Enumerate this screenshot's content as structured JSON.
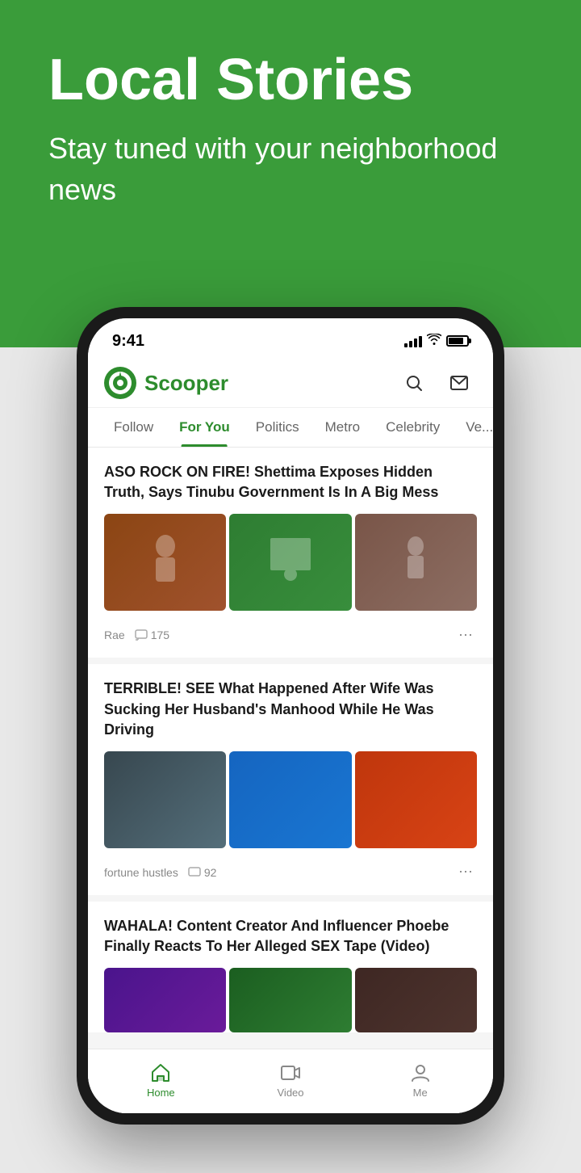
{
  "hero": {
    "title": "Local Stories",
    "subtitle": "Stay tuned with your neighborhood news"
  },
  "phone": {
    "status_bar": {
      "time": "9:41"
    },
    "header": {
      "logo_text": "Scooper"
    },
    "nav_tabs": [
      {
        "label": "Follow",
        "active": false
      },
      {
        "label": "For You",
        "active": true
      },
      {
        "label": "Politics",
        "active": false
      },
      {
        "label": "Metro",
        "active": false
      },
      {
        "label": "Celebrity",
        "active": false
      },
      {
        "label": "Ve...",
        "active": false
      }
    ],
    "articles": [
      {
        "title": "ASO ROCK ON FIRE! Shettima Exposes Hidden Truth, Says Tinubu Government Is In A Big Mess",
        "author": "Rae",
        "comments": "175",
        "images": [
          "img1-1",
          "img1-2",
          "img1-3"
        ]
      },
      {
        "title": "TERRIBLE! SEE What Happened After Wife Was Sucking Her Husband's Manhood While He Was Driving",
        "author": "fortune hustles",
        "comments": "92",
        "images": [
          "img2-1",
          "img2-2",
          "img2-3"
        ]
      },
      {
        "title": "WAHALA! Content Creator And Influencer Phoebe Finally Reacts To Her Alleged SEX Tape (Video)",
        "author": "",
        "comments": "",
        "images": [
          "img3-1",
          "img3-2",
          "img3-3"
        ]
      }
    ],
    "bottom_nav": [
      {
        "label": "Home",
        "active": true,
        "icon": "home"
      },
      {
        "label": "Video",
        "active": false,
        "icon": "video"
      },
      {
        "label": "Me",
        "active": false,
        "icon": "person"
      }
    ]
  },
  "colors": {
    "brand_green": "#2d8c2d",
    "bg_green": "#3a9c3a"
  }
}
